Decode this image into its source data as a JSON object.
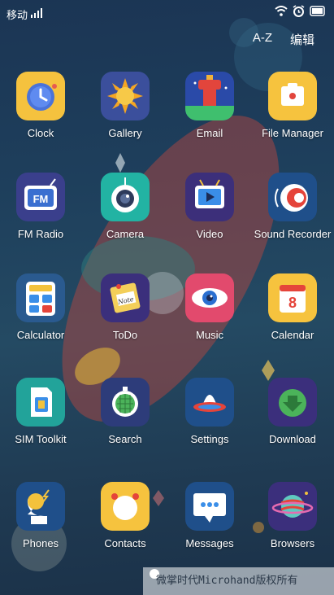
{
  "status_bar": {
    "carrier": "移动"
  },
  "header": {
    "sort_label": "A-Z",
    "edit_label": "编辑"
  },
  "apps": [
    {
      "label": "Clock",
      "icon": "clock-icon"
    },
    {
      "label": "Gallery",
      "icon": "gallery-icon"
    },
    {
      "label": "Email",
      "icon": "email-icon"
    },
    {
      "label": "File Manager",
      "icon": "file-manager-icon"
    },
    {
      "label": "FM Radio",
      "icon": "fm-radio-icon"
    },
    {
      "label": "Camera",
      "icon": "camera-icon"
    },
    {
      "label": "Video",
      "icon": "video-icon"
    },
    {
      "label": "Sound Recorder",
      "icon": "sound-recorder-icon"
    },
    {
      "label": "Calculator",
      "icon": "calculator-icon"
    },
    {
      "label": "ToDo",
      "icon": "todo-icon"
    },
    {
      "label": "Music",
      "icon": "music-icon"
    },
    {
      "label": "Calendar",
      "icon": "calendar-icon"
    },
    {
      "label": "SIM Toolkit",
      "icon": "sim-toolkit-icon"
    },
    {
      "label": "Search",
      "icon": "search-icon"
    },
    {
      "label": "Settings",
      "icon": "settings-icon"
    },
    {
      "label": "Download",
      "icon": "download-icon"
    },
    {
      "label": "Phones",
      "icon": "phones-icon"
    },
    {
      "label": "Contacts",
      "icon": "contacts-icon"
    },
    {
      "label": "Messages",
      "icon": "messages-icon"
    },
    {
      "label": "Browsers",
      "icon": "browsers-icon"
    }
  ],
  "watermark": "微掌时代Microhand版权所有"
}
